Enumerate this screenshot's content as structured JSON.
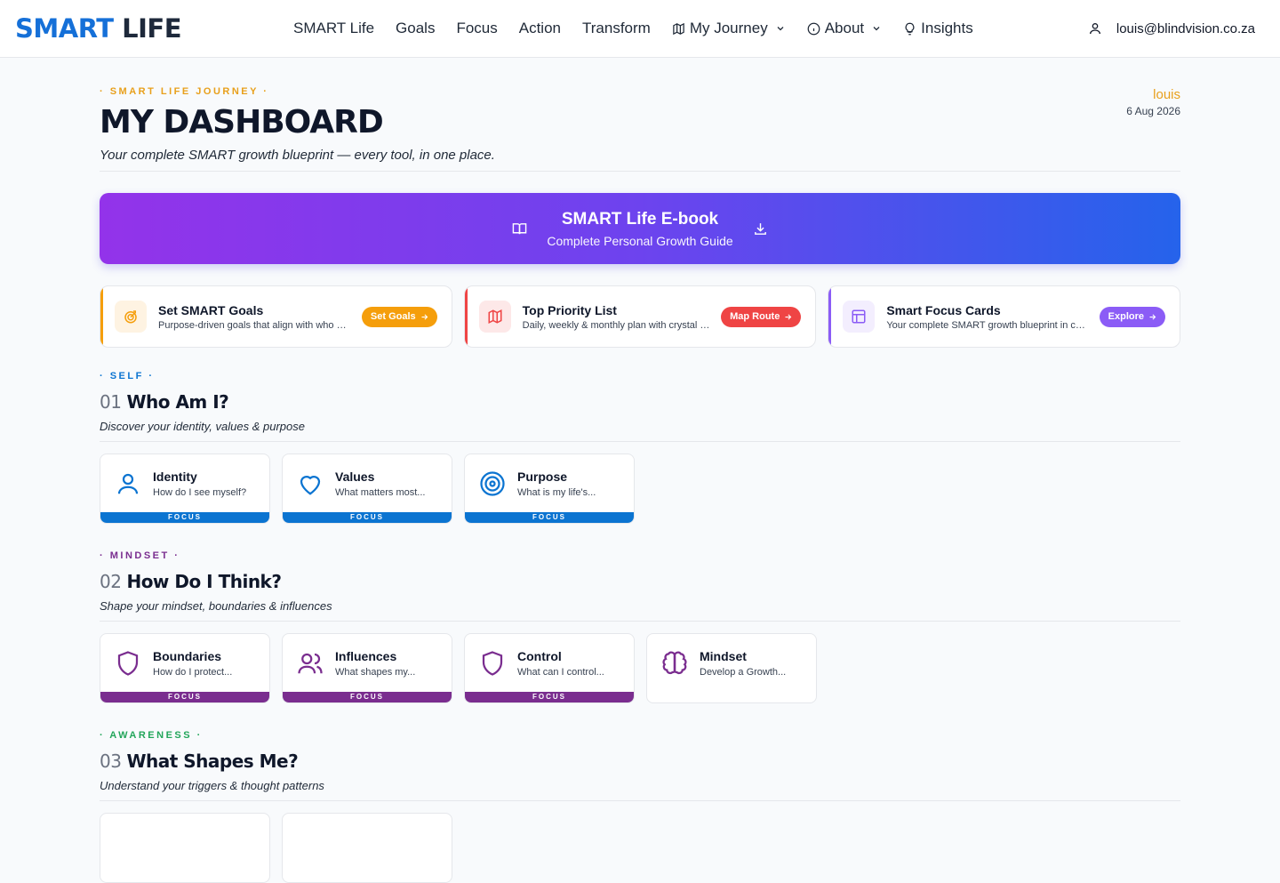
{
  "brand": {
    "smart": "SMART",
    "life": "LIFE"
  },
  "nav": {
    "items": [
      {
        "label": "SMART Life"
      },
      {
        "label": "Goals"
      },
      {
        "label": "Focus"
      },
      {
        "label": "Action"
      },
      {
        "label": "Transform"
      },
      {
        "label": "My Journey"
      },
      {
        "label": "About"
      },
      {
        "label": "Insights"
      }
    ]
  },
  "account": {
    "email": "louis@blindvision.co.za"
  },
  "header": {
    "eyebrow": "· SMART LIFE JOURNEY ·",
    "title": "MY DASHBOARD",
    "subtitle": "Your complete SMART growth blueprint — every tool, in one place.",
    "user_name": "louis",
    "date": "6 Aug 2026"
  },
  "banner": {
    "title": "SMART Life E-book",
    "subtitle": "Complete Personal Growth Guide"
  },
  "features": [
    {
      "title": "Set SMART Goals",
      "desc": "Purpose-driven goals that align with who you are",
      "button": "Set Goals",
      "accent": "#f59e0b"
    },
    {
      "title": "Top Priority List",
      "desc": "Daily, weekly & monthly plan with crystal clarity",
      "button": "Map Route",
      "accent": "#ef4444"
    },
    {
      "title": "Smart Focus Cards",
      "desc": "Your complete SMART growth blueprint in cards",
      "button": "Explore",
      "accent": "#8b5cf6"
    }
  ],
  "sections": [
    {
      "eyebrow": "· SELF ·",
      "color": "#0b74d1",
      "num": "01",
      "title": "Who Am I?",
      "subtitle": "Discover your identity, values & purpose",
      "cards": [
        {
          "title": "Identity",
          "desc": "How do I see myself?",
          "bar": "FOCUS"
        },
        {
          "title": "Values",
          "desc": "What matters most...",
          "bar": "FOCUS"
        },
        {
          "title": "Purpose",
          "desc": "What is my life's...",
          "bar": "FOCUS"
        }
      ]
    },
    {
      "eyebrow": "· MINDSET ·",
      "color": "#7a2d8f",
      "num": "02",
      "title": "How Do I Think?",
      "subtitle": "Shape your mindset, boundaries & influences",
      "cards": [
        {
          "title": "Boundaries",
          "desc": "How do I protect...",
          "bar": "FOCUS"
        },
        {
          "title": "Influences",
          "desc": "What shapes my...",
          "bar": "FOCUS"
        },
        {
          "title": "Control",
          "desc": "What can I control...",
          "bar": "FOCUS"
        },
        {
          "title": "Mindset",
          "desc": "Develop a Growth..."
        }
      ]
    },
    {
      "eyebrow": "· AWARENESS ·",
      "color": "#22a55a",
      "num": "03",
      "title": "What Shapes Me?",
      "subtitle": "Understand your triggers & thought patterns"
    }
  ]
}
